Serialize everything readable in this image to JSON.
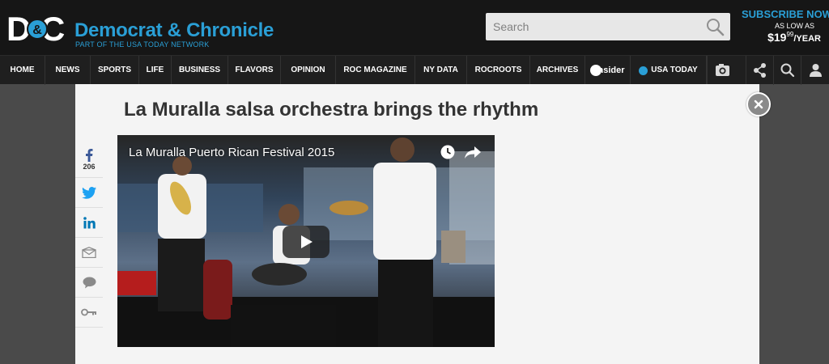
{
  "header": {
    "logo_text": "D&C",
    "brand_name": "Democrat & Chronicle",
    "brand_tagline": "PART OF THE USA TODAY NETWORK",
    "search": {
      "placeholder": "Search"
    },
    "subscribe": {
      "title": "SUBSCRIBE NOW",
      "line2": "AS LOW AS",
      "price_dollar": "$19",
      "price_cents": "99",
      "price_per": "/YEAR"
    }
  },
  "nav": {
    "items": [
      "HOME",
      "NEWS",
      "SPORTS",
      "LIFE",
      "BUSINESS",
      "FLAVORS",
      "OPINION",
      "ROC MAGAZINE",
      "NY DATA",
      "ROCROOTS",
      "ARCHIVES"
    ],
    "insider_label": "insider",
    "usatoday_label": "USA TODAY",
    "icons": [
      "camera-icon",
      "share-icon",
      "search-icon",
      "user-icon"
    ]
  },
  "article": {
    "title": "La Muralla salsa orchestra brings the rhythm",
    "video_title": "La Muralla Puerto Rican Festival 2015"
  },
  "share": {
    "facebook_count": "206"
  },
  "colors": {
    "brand_blue": "#2a9fd6",
    "facebook": "#3b5998",
    "twitter": "#1da1f2",
    "linkedin": "#0077b5"
  }
}
